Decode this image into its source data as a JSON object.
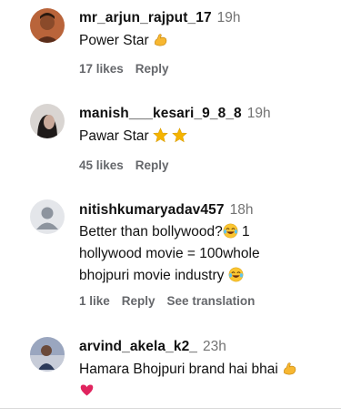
{
  "comments": [
    {
      "username": "mr_arjun_rajput_17",
      "time": "19h",
      "text": "Power Star",
      "likes": "17 likes",
      "reply": "Reply"
    },
    {
      "username": "manish___kesari_9_8_8",
      "time": "19h",
      "text": "Pawar Star",
      "likes": "45 likes",
      "reply": "Reply"
    },
    {
      "username": "nitishkumaryadav457",
      "time": "18h",
      "text_line1": "Better than bollywood?",
      "text_line1b": " 1",
      "text_line2": "hollywood movie = 100whole",
      "text_line3": "bhojpuri movie industry",
      "likes": "1 like",
      "reply": "Reply",
      "translate": "See translation"
    },
    {
      "username": "arvind_akela_k2_",
      "time": "23h",
      "text": "Hamara Bhojpuri brand hai bhai"
    }
  ],
  "icons": {
    "muscle": "flexed-biceps-emoji",
    "star": "star-emoji",
    "laugh": "tears-of-joy-emoji",
    "heart": "red-heart-emoji"
  },
  "colors": {
    "muted": "#737373",
    "action": "#65676b",
    "muscle": "#f7b731",
    "star": "#f5b400",
    "heart": "#e0245e"
  }
}
